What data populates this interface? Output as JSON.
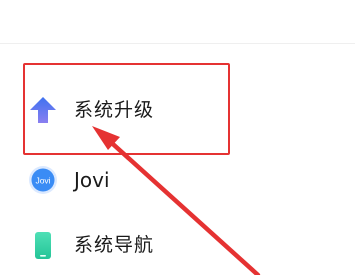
{
  "settings_list": {
    "items": [
      {
        "label": "系统升级",
        "icon": "system-update-arrow-icon"
      },
      {
        "label": "Jovi",
        "icon": "jovi-icon",
        "icon_text": "Jovi"
      },
      {
        "label": "系统导航",
        "icon": "phone-navigation-icon"
      }
    ]
  },
  "annotation": {
    "highlight_color": "#e53232",
    "target": "系统升级"
  },
  "colors": {
    "update_icon_top": "#3f72f0",
    "update_icon_bottom": "#8a7ff0",
    "jovi_icon": "#3a8cf5",
    "nav_icon": "#3fd6a8"
  }
}
